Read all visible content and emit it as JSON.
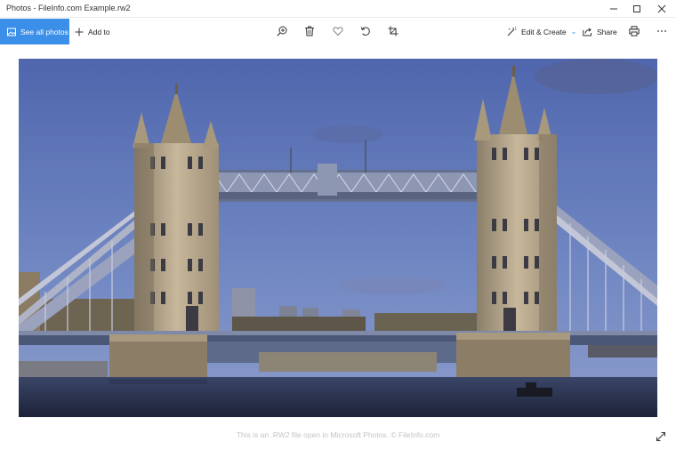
{
  "window": {
    "title": "Photos - FileInfo.com Example.rw2"
  },
  "toolbar": {
    "see_all_label": "See all photos",
    "add_to_label": "Add to",
    "edit_create_label": "Edit & Create",
    "share_label": "Share",
    "icons": [
      "zoom-in-icon",
      "delete-icon",
      "favorite-icon",
      "rotate-icon",
      "crop-icon",
      "print-icon",
      "more-icon"
    ]
  },
  "footer": {
    "caption": "This is an .RW2 file open in Microsoft Photos. © FileInfo.com"
  },
  "colors": {
    "accent": "#3b8fe8",
    "caption": "#c4c4c4"
  }
}
